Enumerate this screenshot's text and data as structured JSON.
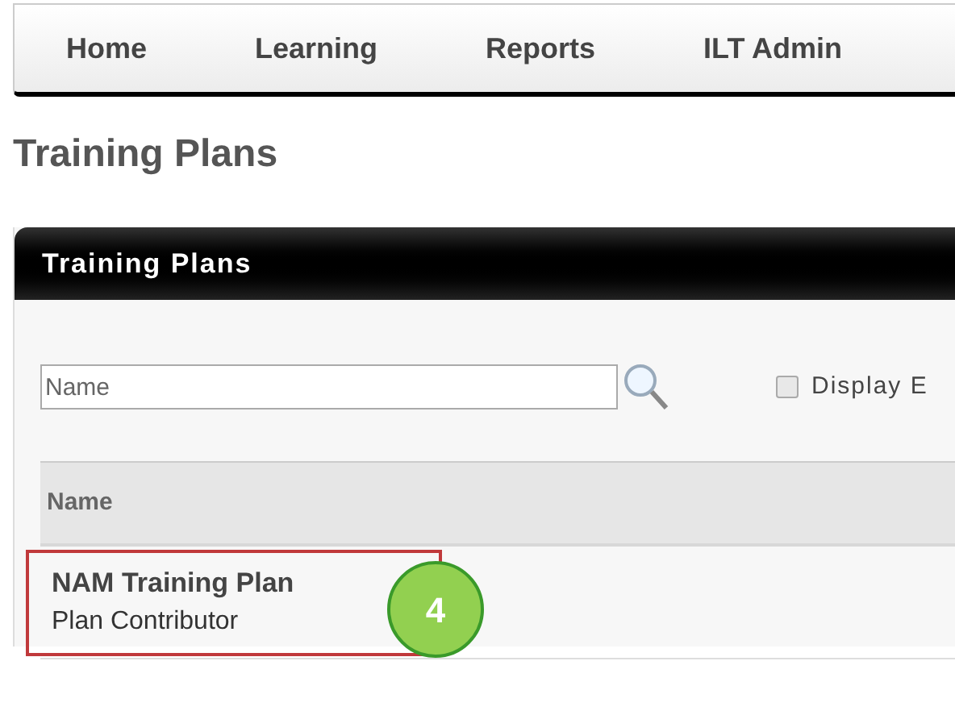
{
  "nav": {
    "items": [
      {
        "label": "Home"
      },
      {
        "label": "Learning"
      },
      {
        "label": "Reports"
      },
      {
        "label": "ILT Admin"
      }
    ]
  },
  "page_title": "Training Plans",
  "panel": {
    "title": "Training Plans",
    "search": {
      "placeholder": "Name"
    },
    "checkbox": {
      "label": "Display E",
      "checked": false
    },
    "table": {
      "columns": [
        "Name"
      ],
      "rows": [
        {
          "name": "NAM Training Plan",
          "role": "Plan Contributor",
          "highlighted": true
        }
      ]
    }
  },
  "callout": {
    "label": "4"
  }
}
